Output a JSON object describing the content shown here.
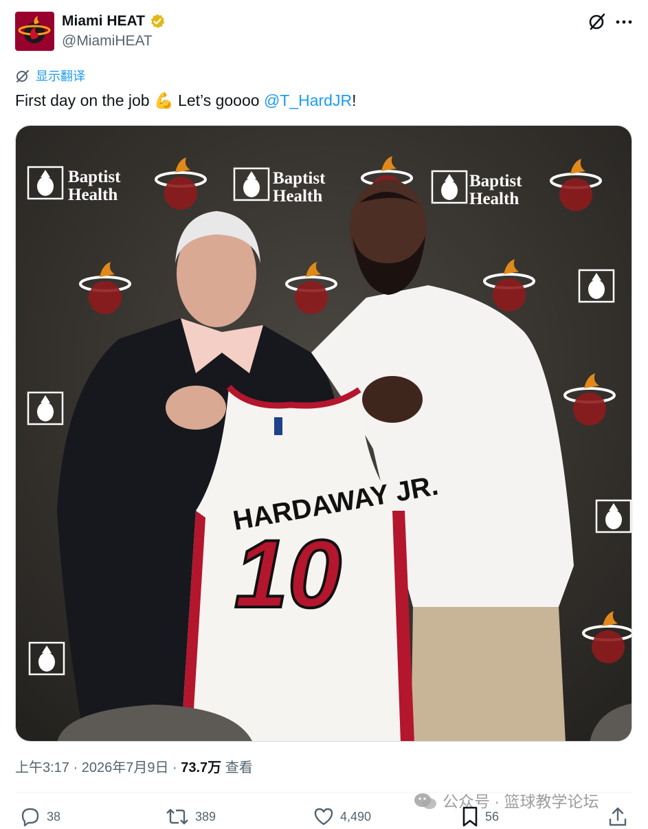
{
  "account": {
    "name": "Miami HEAT",
    "handle": "@MiamiHEAT",
    "verified": true,
    "avatar_color": "#98002e"
  },
  "translate_label": "显示翻译",
  "tweet": {
    "text_before": "First day on the job ",
    "emoji": "💪",
    "text_middle": " Let’s goooo ",
    "mention": "@T_HardJR",
    "text_after": "!"
  },
  "photo": {
    "sponsor_line1": "Baptist",
    "sponsor_line2": "Health",
    "jersey_name": "HARDAWAY JR.",
    "jersey_number": "10"
  },
  "meta": {
    "time": "上午3:17",
    "separator": " · ",
    "date": "2026年7月9日",
    "views": "73.7万",
    "views_label": "查看"
  },
  "actions": {
    "replies": "38",
    "reposts": "389",
    "likes": "4,490",
    "bookmarks": "56"
  },
  "watermark": "公众号 · 篮球教学论坛",
  "colors": {
    "link": "#1d9bf0",
    "secondary_text": "#536471",
    "heat_red": "#98002e",
    "verified_gold": "#e2b719"
  }
}
